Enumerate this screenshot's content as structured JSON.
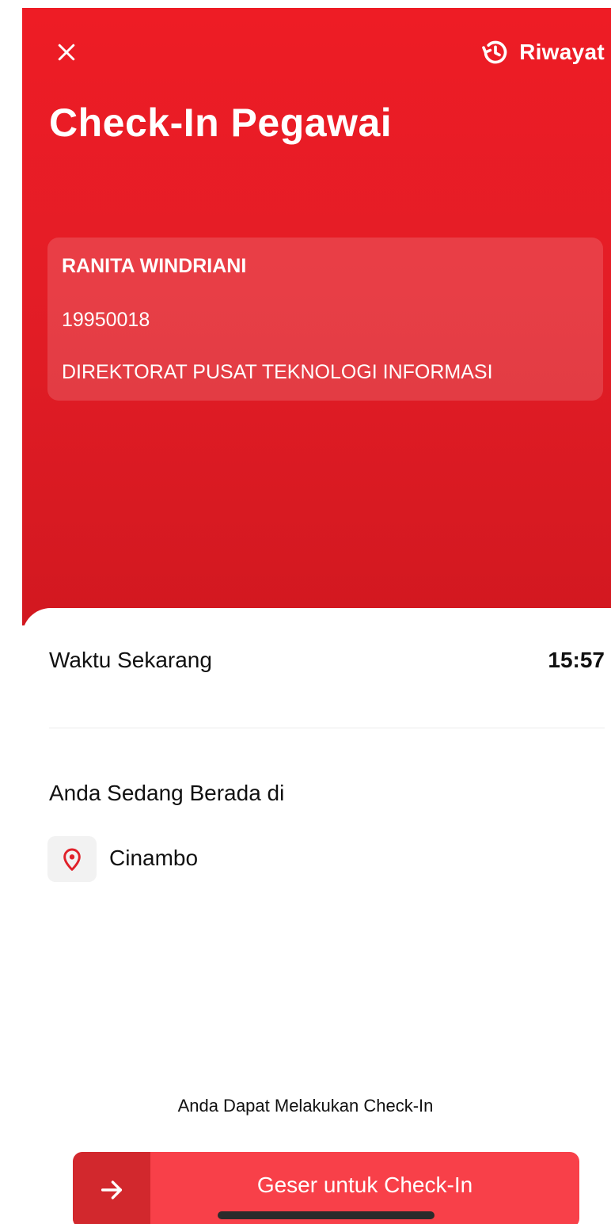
{
  "header": {
    "title": "Check-In Pegawai",
    "history_label": "Riwayat",
    "close_icon": "close-icon",
    "history_icon": "history-clock-icon"
  },
  "employee": {
    "name": "RANITA WINDRIANI",
    "id": "19950018",
    "department": "DIREKTORAT PUSAT TEKNOLOGI INFORMASI"
  },
  "time": {
    "label": "Waktu Sekarang",
    "value": "15:57"
  },
  "location": {
    "heading": "Anda Sedang Berada di",
    "name": "Cinambo",
    "icon": "location-pin-icon"
  },
  "checkin": {
    "status_text": "Anda Dapat Melakukan Check-In",
    "slider_label": "Geser untuk Check-In",
    "slider_icon": "arrow-right-icon"
  },
  "colors": {
    "primary_red": "#ee1c25",
    "slider_red": "#f84049",
    "slider_handle": "#d2282d"
  }
}
